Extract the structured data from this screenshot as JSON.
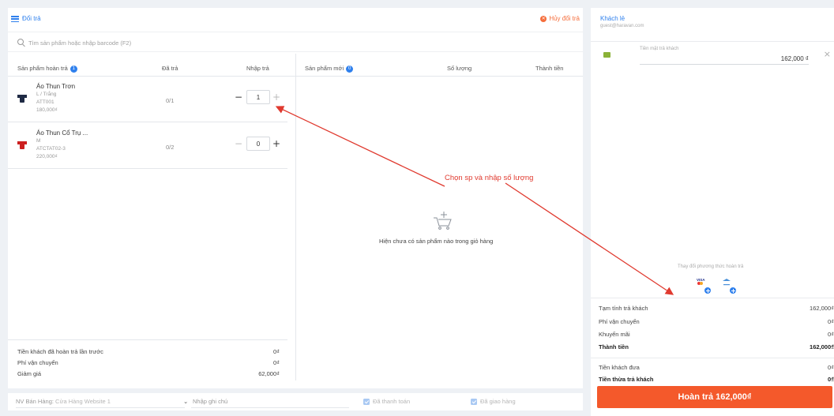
{
  "header": {
    "title": "Đổi trả",
    "cancel_label": "Hủy đổi trả"
  },
  "search": {
    "placeholder": "Tìm sản phẩm hoặc nhập barcode (F2)"
  },
  "return_table": {
    "col_product": "Sản phẩm hoàn trả",
    "badge_count": "1",
    "col_returned": "Đã trả",
    "col_input": "Nhập trả",
    "items": [
      {
        "name": "Áo Thun Trơn",
        "variant": "L / Trắng",
        "sku": "ATT001",
        "price": "180,000₫",
        "returned": "0/1",
        "qty": "1",
        "color": "#1f2a44"
      },
      {
        "name": "Áo Thun Cổ Trụ ...",
        "variant": "M",
        "sku": "ATCTAT02-3",
        "price": "220,000₫",
        "returned": "0/2",
        "qty": "0",
        "color": "#cc1f1f"
      }
    ]
  },
  "new_table": {
    "col_product": "Sản phẩm mới",
    "badge_count": "0",
    "col_qty": "Số lượng",
    "col_total": "Thành tiền",
    "empty_text": "Hiện chưa có sản phẩm nào trong giỏ hàng"
  },
  "annotation": "Chọn sp và nhập số lượng",
  "left_summary": {
    "prev_refund_label": "Tiền khách đã hoàn trả lần trước",
    "prev_refund_value": "0₫",
    "shipping_label": "Phí vận chuyển",
    "shipping_value": "0₫",
    "discount_label": "Giảm giá",
    "discount_value": "62,000₫"
  },
  "bottom": {
    "staff_label": "NV Bán Hàng:",
    "staff_value": "Cửa Hàng Website 1",
    "note_placeholder": "Nhập ghi chú",
    "paid_label": "Đã thanh toán",
    "delivered_label": "Đã giao hàng"
  },
  "customer": {
    "name": "Khách lẻ",
    "email": "guest@haravan.com"
  },
  "payment": {
    "label": "Tiền mặt trả khách",
    "amount": "162,000 ₫",
    "change_method": "Thay đổi phương thức hoàn trả",
    "visa_text": "VISA"
  },
  "totals": {
    "subtotal_label": "Tạm tính trả khách",
    "subtotal_value": "162,000₫",
    "shipping_label": "Phí vận chuyển",
    "shipping_value": "0₫",
    "promo_label": "Khuyến mãi",
    "promo_value": "0₫",
    "total_label": "Thành tiền",
    "total_value": "162,000₫",
    "given_label": "Tiền khách đưa",
    "given_value": "0₫",
    "change_label": "Tiền thừa trả khách",
    "change_value": "0₫"
  },
  "submit_label": "Hoàn trả 162,000₫",
  "colors": {
    "accent": "#2f80ed",
    "cta": "#f4592b",
    "annotation": "#e03a2f"
  }
}
